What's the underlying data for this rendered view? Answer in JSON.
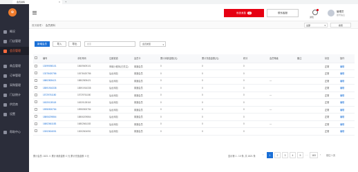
{
  "browser": {
    "tab_title": "会员资料",
    "close": "×",
    "new_tab": "+"
  },
  "sidebar": {
    "logo": "✿",
    "items": [
      {
        "label": "概况"
      },
      {
        "label": "门店管理"
      },
      {
        "label": "会员管理"
      },
      {
        "label": "商品管理"
      },
      {
        "label": "订单管理"
      },
      {
        "label": "采购管理"
      },
      {
        "label": "门店统计"
      },
      {
        "label": "供货商"
      },
      {
        "label": "设置"
      },
      {
        "label": "帮助中心"
      }
    ]
  },
  "header": {
    "msg_button": "系统消息",
    "msg_badge": "99",
    "notice_button": "联系客服",
    "icon_label": "通知",
    "user_name": "管理员",
    "user_sub": "账号信息"
  },
  "breadcrumb": {
    "home": "首页管理",
    "current": "会员资料"
  },
  "store": {
    "select_value": "全部",
    "button": "搜索"
  },
  "toolbar": {
    "add_label": "新增会员",
    "import_label": "导入",
    "export_label": "导出",
    "search_placeholder": "搜索",
    "filter_label": "会员类型"
  },
  "table": {
    "headers": [
      "",
      "编号",
      "手机号码",
      "注册渠道",
      "会员卡",
      "累计消费金额(元)",
      "累计充值金额(元)",
      "积分",
      "会员等级",
      "备注",
      "状态",
      "操作"
    ],
    "rows": [
      {
        "id": "13099098101",
        "phone": "15609609101",
        "channel": "商城小程序(已关注)",
        "card": "普通会员",
        "spend": "0",
        "charge": "0",
        "points": "0",
        "level": "",
        "note": "",
        "status": "正常",
        "op": "编辑"
      },
      {
        "id": "13378420786",
        "phone": "15378420786",
        "channel": "后台添加",
        "card": "普通会员",
        "spend": "0",
        "charge": "0",
        "points": "0",
        "level": "",
        "note": "",
        "status": "正常",
        "op": "编辑"
      },
      {
        "id": "18802805421",
        "phone": "18802805421",
        "channel": "后台添加",
        "card": "普通会员",
        "spend": "0",
        "charge": "0",
        "points": "0",
        "level": "—",
        "note": "",
        "status": "正常",
        "op": "编辑"
      },
      {
        "id": "18591916338",
        "phone": "18591916338",
        "channel": "后台添加",
        "card": "普通会员",
        "spend": "0",
        "charge": "0",
        "points": "0",
        "level": "",
        "note": "",
        "status": "正常",
        "op": "编辑"
      },
      {
        "id": "15729761180",
        "phone": "15729761180",
        "channel": "后台添加",
        "card": "普通会员",
        "spend": "0",
        "charge": "0",
        "points": "0",
        "level": "—",
        "note": "",
        "status": "正常",
        "op": "编辑"
      },
      {
        "id": "16320128118",
        "phone": "16320128118",
        "channel": "后台添加",
        "card": "普通会员",
        "spend": "0",
        "charge": "0",
        "points": "0",
        "level": "",
        "note": "",
        "status": "正常",
        "op": "编辑"
      },
      {
        "id": "15950500784",
        "phone": "15950500784",
        "channel": "后台添加",
        "card": "普通会员",
        "spend": "0",
        "charge": "0",
        "points": "0",
        "level": "—",
        "note": "",
        "status": "正常",
        "op": "编辑"
      },
      {
        "id": "18806209864",
        "phone": "18806209864",
        "channel": "后台添加",
        "card": "普通会员",
        "spend": "0",
        "charge": "0",
        "points": "0",
        "level": "",
        "note": "",
        "status": "正常",
        "op": "编辑"
      },
      {
        "id": "16802661183",
        "phone": "16802661183",
        "channel": "后台添加",
        "card": "普通会员",
        "spend": "0",
        "charge": "0",
        "points": "0",
        "level": "—",
        "note": "",
        "status": "正常",
        "op": "编辑"
      },
      {
        "id": "13002604051",
        "phone": "13002604051",
        "channel": "后台添加",
        "card": "普通会员",
        "spend": "0",
        "charge": "0",
        "points": "0",
        "level": "",
        "note": "",
        "status": "正常",
        "op": "编辑"
      }
    ]
  },
  "footer": {
    "summary": "累计会员: 1821 人 累计消费金额: 0 元 累计充值金额: 0 元",
    "page_info": "显示第 1 - 10 条, 共 1821 条",
    "pages": [
      "1",
      "2",
      "3",
      "4",
      "5"
    ],
    "prev": "‹",
    "next": "›",
    "ellipsis": "…",
    "last_page": "183",
    "jump": "前往 1 页"
  }
}
